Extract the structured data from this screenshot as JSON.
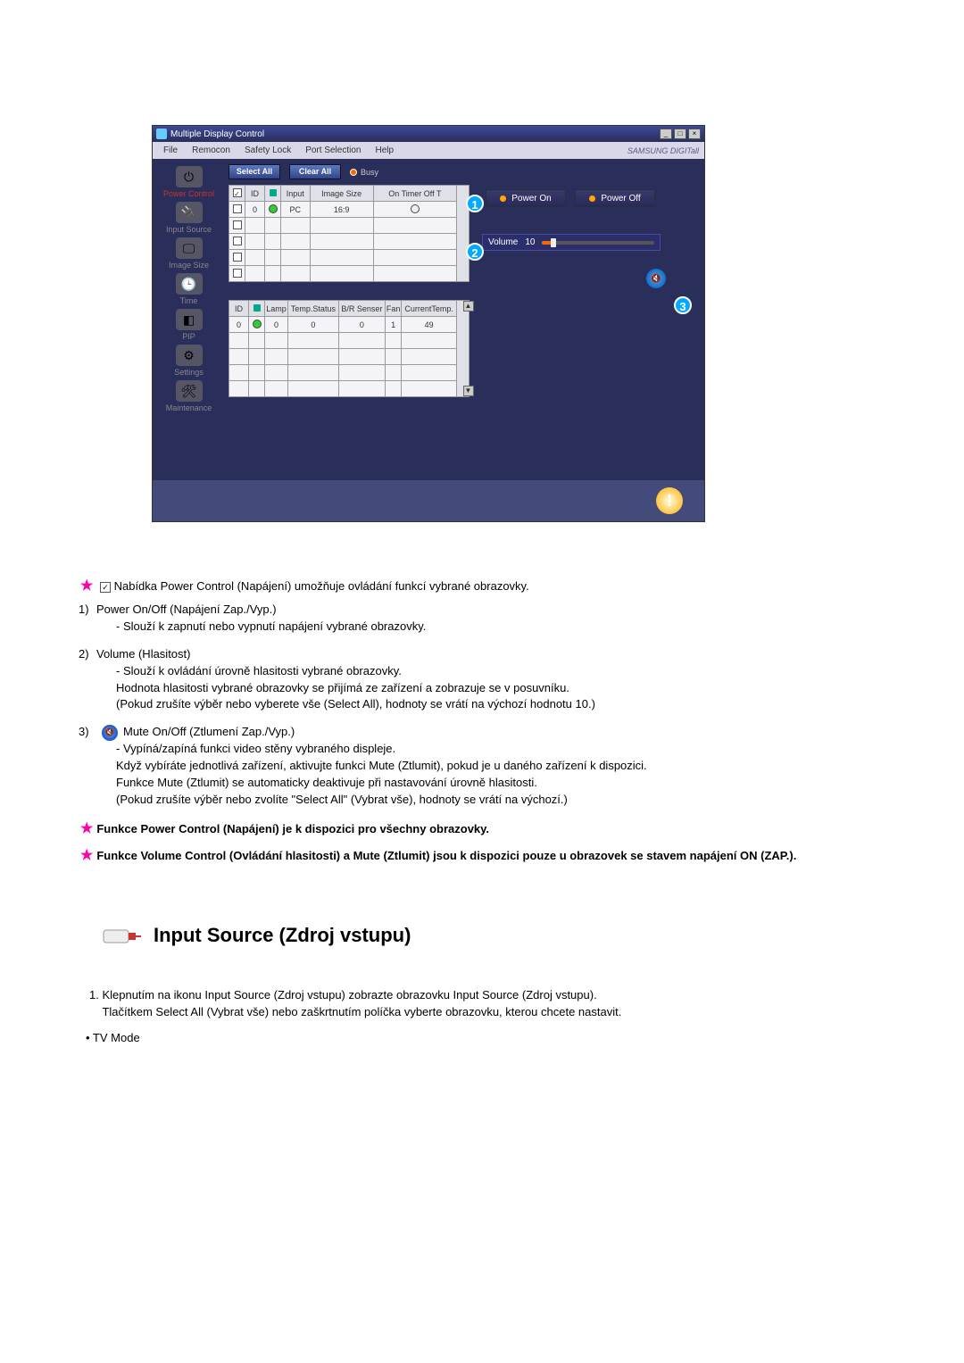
{
  "app": {
    "title": "Multiple Display Control",
    "brand": "SAMSUNG DIGITall",
    "menu": [
      "File",
      "Remocon",
      "Safety Lock",
      "Port Selection",
      "Help"
    ],
    "win_buttons": {
      "min": "_",
      "max": "□",
      "close": "×"
    },
    "sidebar": [
      {
        "label": "Power Control",
        "active": true,
        "glyph": "⏻"
      },
      {
        "label": "Input Source",
        "glyph": "🔌"
      },
      {
        "label": "Image Size",
        "glyph": "🖵"
      },
      {
        "label": "Time",
        "glyph": "🕒"
      },
      {
        "label": "PIP",
        "glyph": "◧"
      },
      {
        "label": "Settings",
        "glyph": "⚙"
      },
      {
        "label": "Maintenance",
        "glyph": "🛠"
      }
    ],
    "toolbar": {
      "select_all": "Select All",
      "clear_all": "Clear All",
      "busy": "Busy"
    },
    "table1": {
      "headers": [
        "",
        "ID",
        "",
        "Input",
        "Image Size",
        "On Timer Off T"
      ],
      "rows": [
        {
          "chk": true,
          "id": "0",
          "led": "green",
          "input": "PC",
          "size": "16:9",
          "timer": "○"
        },
        {
          "chk": false
        },
        {
          "chk": false
        },
        {
          "chk": false
        },
        {
          "chk": false
        }
      ]
    },
    "table2": {
      "headers": [
        "ID",
        "",
        "Lamp",
        "Temp.Status",
        "B/R Senser",
        "Fan",
        "CurrentTemp."
      ],
      "rows": [
        {
          "id": "0",
          "led": "green",
          "lamp": "0",
          "temp": "0",
          "br": "0",
          "fan": "1",
          "ct": "49"
        },
        {},
        {},
        {},
        {}
      ]
    },
    "right": {
      "power_on": "Power On",
      "power_off": "Power Off",
      "volume_label": "Volume",
      "volume_value": "10"
    },
    "callouts": {
      "c1": "1",
      "c2": "2",
      "c3": "3"
    },
    "status_glyph": "!"
  },
  "doc": {
    "intro": "Nabídka Power Control (Napájení) umožňuje ovládání funkcí vybrané obrazovky.",
    "items": [
      {
        "num": "1)",
        "title": "Power On/Off (Napájení Zap./Vyp.)",
        "lines": [
          "- Slouží k zapnutí nebo vypnutí napájení vybrané obrazovky."
        ]
      },
      {
        "num": "2)",
        "title": "Volume (Hlasitost)",
        "lines": [
          "- Slouží k ovládání úrovně hlasitosti vybrané obrazovky.",
          "Hodnota hlasitosti vybrané obrazovky se přijímá ze zařízení a zobrazuje se v posuvníku.",
          "(Pokud zrušíte výběr nebo vyberete vše (Select All), hodnoty se vrátí na výchozí hodnotu 10.)"
        ]
      },
      {
        "num": "3)",
        "icon": true,
        "title": "Mute On/Off (Ztlumení Zap./Vyp.)",
        "lines": [
          "- Vypíná/zapíná funkci video stěny vybraného displeje.",
          "Když vybíráte jednotlivá zařízení, aktivujte funkci Mute (Ztlumit), pokud je u daného zařízení k dispozici.",
          "Funkce Mute (Ztlumit) se automaticky deaktivuje při nastavování úrovně hlasitosti.",
          "(Pokud zrušíte výběr nebo zvolíte \"Select All\" (Vybrat vše), hodnoty se vrátí na výchozí.)"
        ]
      }
    ],
    "notes": [
      "Funkce Power Control (Napájení) je k dispozici pro všechny obrazovky.",
      "Funkce Volume Control (Ovládání hlasitosti) a Mute (Ztlumit) jsou k dispozici pouze u obrazovek se stavem napájení ON (ZAP.)."
    ],
    "section_title": "Input Source (Zdroj vstupu)",
    "section_p1a": "1. Klepnutím na ikonu Input Source (Zdroj vstupu) zobrazte obrazovku Input Source (Zdroj vstupu).",
    "section_p1b": "Tlačítkem Select All (Vybrat vše) nebo zaškrtnutím políčka vyberte obrazovku, kterou chcete nastavit.",
    "bullet": "• TV Mode"
  }
}
